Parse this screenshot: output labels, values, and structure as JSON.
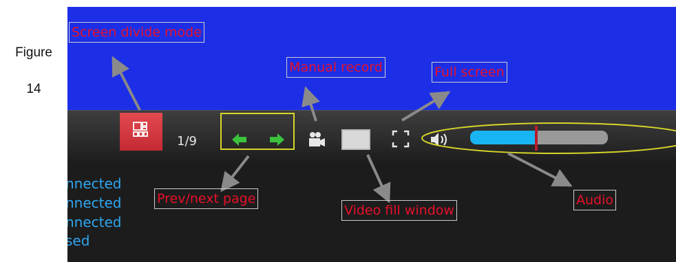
{
  "caption": {
    "line1": "Figure",
    "line2": "14"
  },
  "toolbar": {
    "page_indicator": "1/9"
  },
  "status_lines": [
    "nnected",
    "nnected",
    "nnected",
    "sed"
  ],
  "annotations": {
    "screen_divide": "Screen divide mode",
    "manual_record": "Manual record",
    "full_screen": "Full screen",
    "prev_next": "Prev/next page",
    "video_fill": "Video fill window",
    "audio": "Audio"
  },
  "audio_level": 0.48,
  "colors": {
    "video_bg": "#1d2fe6",
    "annotation_text": "#e8102a",
    "divide_button": "#d6303a",
    "arrow_green": "#3cc23c",
    "audio_fill": "#19b4f2",
    "status_text": "#2fa6ee"
  },
  "icons": [
    "screen-divide-icon",
    "prev-arrow-icon",
    "next-arrow-icon",
    "record-camera-icon",
    "fill-window-icon",
    "full-screen-icon",
    "speaker-icon"
  ]
}
